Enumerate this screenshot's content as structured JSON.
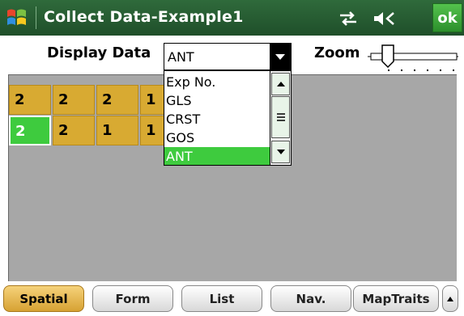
{
  "titlebar": {
    "title": "Collect Data-Example1",
    "ok_label": "ok",
    "icons": [
      "windows-start-icon",
      "connectivity-icon",
      "volume-icon"
    ]
  },
  "toolbar": {
    "display_data_label": "Display Data",
    "display_data_selected": "ANT",
    "zoom_label": "Zoom",
    "zoom_level": 0.1
  },
  "grid": {
    "rows": [
      [
        "2",
        "2",
        "2",
        "1"
      ],
      [
        "2",
        "2",
        "1",
        "1"
      ]
    ],
    "selected_cell": {
      "row": 1,
      "col": 0
    }
  },
  "dropdown": {
    "options": [
      "Exp No.",
      "GLS",
      "CRST",
      "GOS",
      "ANT"
    ],
    "selected_index": 4
  },
  "tabs": [
    {
      "label": "Spatial",
      "active": true
    },
    {
      "label": "Form",
      "active": false
    },
    {
      "label": "List",
      "active": false
    },
    {
      "label": "Nav.",
      "active": false
    },
    {
      "label": "MapTraits",
      "active": false
    }
  ],
  "colors": {
    "titlebar": "#24562f",
    "cell": "#d8aa32",
    "selected": "#3ecb3e",
    "map_bg": "#a7a7a7"
  }
}
